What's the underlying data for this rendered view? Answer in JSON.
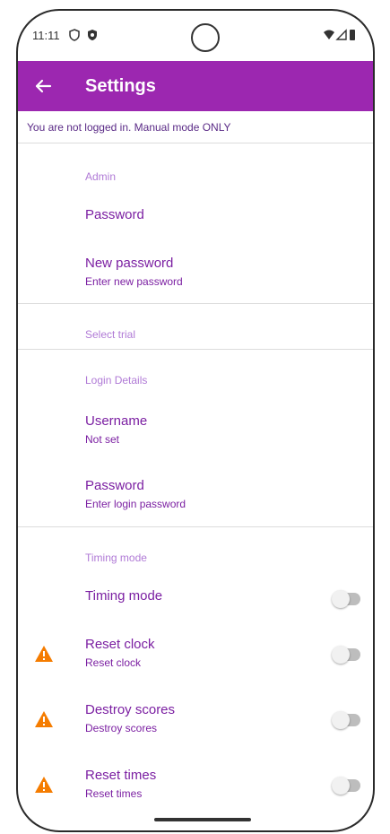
{
  "status_bar": {
    "time": "11:11"
  },
  "appbar": {
    "title": "Settings"
  },
  "notice": "You are not logged in. Manual mode ONLY",
  "admin": {
    "header": "Admin",
    "password_title": "Password",
    "new_password_title": "New password",
    "new_password_sub": "Enter new password"
  },
  "select_trial": {
    "header": "Select trial"
  },
  "login": {
    "header": "Login Details",
    "username_title": "Username",
    "username_sub": "Not set",
    "password_title": "Password",
    "password_sub": "Enter login password"
  },
  "timing": {
    "header": "Timing mode",
    "timing_mode_title": "Timing mode",
    "reset_clock_title": "Reset clock",
    "reset_clock_sub": "Reset clock",
    "destroy_scores_title": "Destroy scores",
    "destroy_scores_sub": "Destroy scores",
    "reset_times_title": "Reset times",
    "reset_times_sub": "Reset times"
  },
  "colors": {
    "primary": "#9c27b0",
    "accent_text": "#7b1fa2",
    "warning": "#f57c00"
  }
}
